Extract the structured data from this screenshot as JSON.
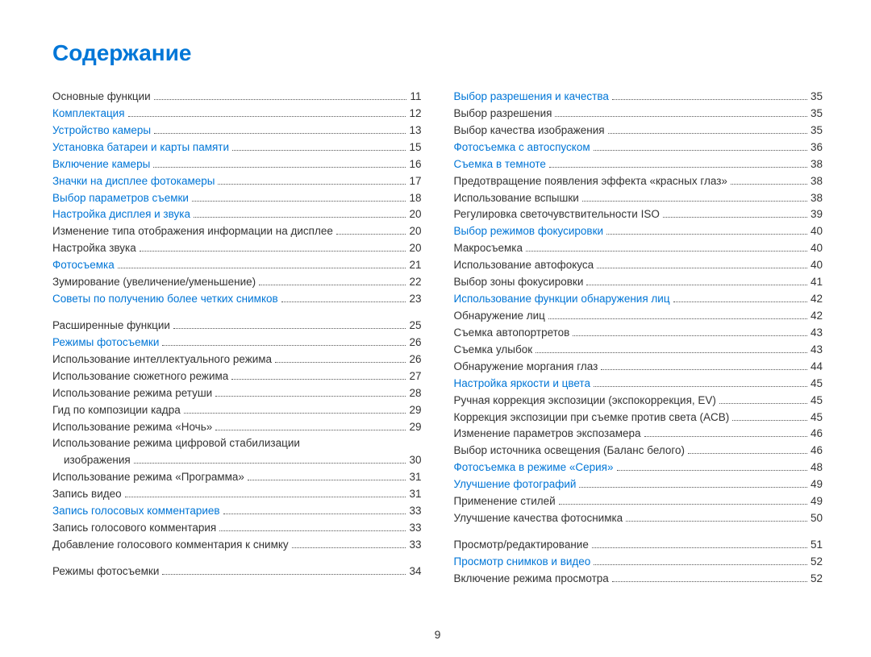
{
  "title": "Содержание",
  "page_number": "9",
  "left": [
    {
      "label": "Основные функции",
      "page": "11",
      "link": false,
      "pad": false
    },
    {
      "label": "Комплектация",
      "page": "12",
      "link": true
    },
    {
      "label": "Устройство камеры",
      "page": "13",
      "link": true
    },
    {
      "label": "Установка батареи и карты памяти",
      "page": "15",
      "link": true
    },
    {
      "label": "Включение камеры",
      "page": "16",
      "link": true
    },
    {
      "label": "Значки на дисплее фотокамеры",
      "page": "17",
      "link": true
    },
    {
      "label": "Выбор параметров съемки",
      "page": "18",
      "link": true
    },
    {
      "label": "Настройка дисплея и звука",
      "page": "20",
      "link": true
    },
    {
      "label": "Изменение типа отображения информации на дисплее",
      "page": "20",
      "link": false
    },
    {
      "label": "Настройка звука",
      "page": "20",
      "link": false
    },
    {
      "label": "Фотосъемка",
      "page": "21",
      "link": true
    },
    {
      "label": "Зумирование (увеличение/уменьшение)",
      "page": "22",
      "link": false
    },
    {
      "label": "Советы по получению более четких снимков",
      "page": "23",
      "link": true
    },
    {
      "label": "Расширенные функции",
      "page": "25",
      "link": false,
      "pad": true
    },
    {
      "label": "Режимы фотосъемки",
      "page": "26",
      "link": true
    },
    {
      "label": "Использование интеллектуального режима",
      "page": "26",
      "link": false
    },
    {
      "label": "Использование сюжетного режима",
      "page": "27",
      "link": false
    },
    {
      "label": "Использование режима ретуши",
      "page": "28",
      "link": false
    },
    {
      "label": "Гид по композиции кадра",
      "page": "29",
      "link": false
    },
    {
      "label": "Использование режима «Ночь»",
      "page": "29",
      "link": false
    },
    {
      "label": "Использование режима цифровой стабилизации",
      "wrap_tail": "изображения",
      "page": "30",
      "link": false
    },
    {
      "label": "Использование режима «Программа»",
      "page": "31",
      "link": false
    },
    {
      "label": "Запись видео",
      "page": "31",
      "link": false
    },
    {
      "label": "Запись голосовых комментариев",
      "page": "33",
      "link": true
    },
    {
      "label": "Запись голосового комментария",
      "page": "33",
      "link": false
    },
    {
      "label": "Добавление голосового комментария к снимку",
      "page": "33",
      "link": false
    },
    {
      "label": "Режимы фотосъемки",
      "page": "34",
      "link": false,
      "pad": true
    }
  ],
  "right": [
    {
      "label": "Выбор разрешения и качества",
      "page": "35",
      "link": true
    },
    {
      "label": "Выбор разрешения",
      "page": "35",
      "link": false
    },
    {
      "label": "Выбор качества изображения",
      "page": "35",
      "link": false
    },
    {
      "label": "Фотосъемка с автоспуском",
      "page": "36",
      "link": true
    },
    {
      "label": "Съемка в темноте",
      "page": "38",
      "link": true
    },
    {
      "label": "Предотвращение появления эффекта «красных глаз»",
      "page": "38",
      "link": false
    },
    {
      "label": "Использование вспышки",
      "page": "38",
      "link": false
    },
    {
      "label": "Регулировка светочувствительности ISO",
      "page": "39",
      "link": false
    },
    {
      "label": "Выбор режимов фокусировки",
      "page": "40",
      "link": true
    },
    {
      "label": "Макросъемка",
      "page": "40",
      "link": false
    },
    {
      "label": "Использование автофокуса",
      "page": "40",
      "link": false
    },
    {
      "label": "Выбор зоны фокусировки",
      "page": "41",
      "link": false
    },
    {
      "label": "Использование функции обнаружения лиц",
      "page": "42",
      "link": true
    },
    {
      "label": "Обнаружение лиц",
      "page": "42",
      "link": false
    },
    {
      "label": "Съемка автопортретов",
      "page": "43",
      "link": false
    },
    {
      "label": "Съемка улыбок",
      "page": "43",
      "link": false
    },
    {
      "label": "Обнаружение моргания глаз",
      "page": "44",
      "link": false
    },
    {
      "label": "Настройка яркости и цвета",
      "page": "45",
      "link": true
    },
    {
      "label": "Ручная коррекция экспозиции (экспокоррекция, EV)",
      "page": "45",
      "link": false
    },
    {
      "label": "Коррекция экспозиции при съемке против света (ACB)",
      "page": "45",
      "link": false
    },
    {
      "label": "Изменение параметров экспозамера",
      "page": "46",
      "link": false
    },
    {
      "label": "Выбор источника освещения (Баланс белого)",
      "page": "46",
      "link": false
    },
    {
      "label": "Фотосъемка в режиме «Серия»",
      "page": "48",
      "link": true
    },
    {
      "label": "Улучшение фотографий",
      "page": "49",
      "link": true
    },
    {
      "label": "Применение стилей",
      "page": "49",
      "link": false
    },
    {
      "label": "Улучшение качества фотоснимка",
      "page": "50",
      "link": false
    },
    {
      "label": "Просмотр/редактирование",
      "page": "51",
      "link": false,
      "pad": true
    },
    {
      "label": "Просмотр снимков и видео",
      "page": "52",
      "link": true
    },
    {
      "label": "Включение режима просмотра",
      "page": "52",
      "link": false
    }
  ]
}
